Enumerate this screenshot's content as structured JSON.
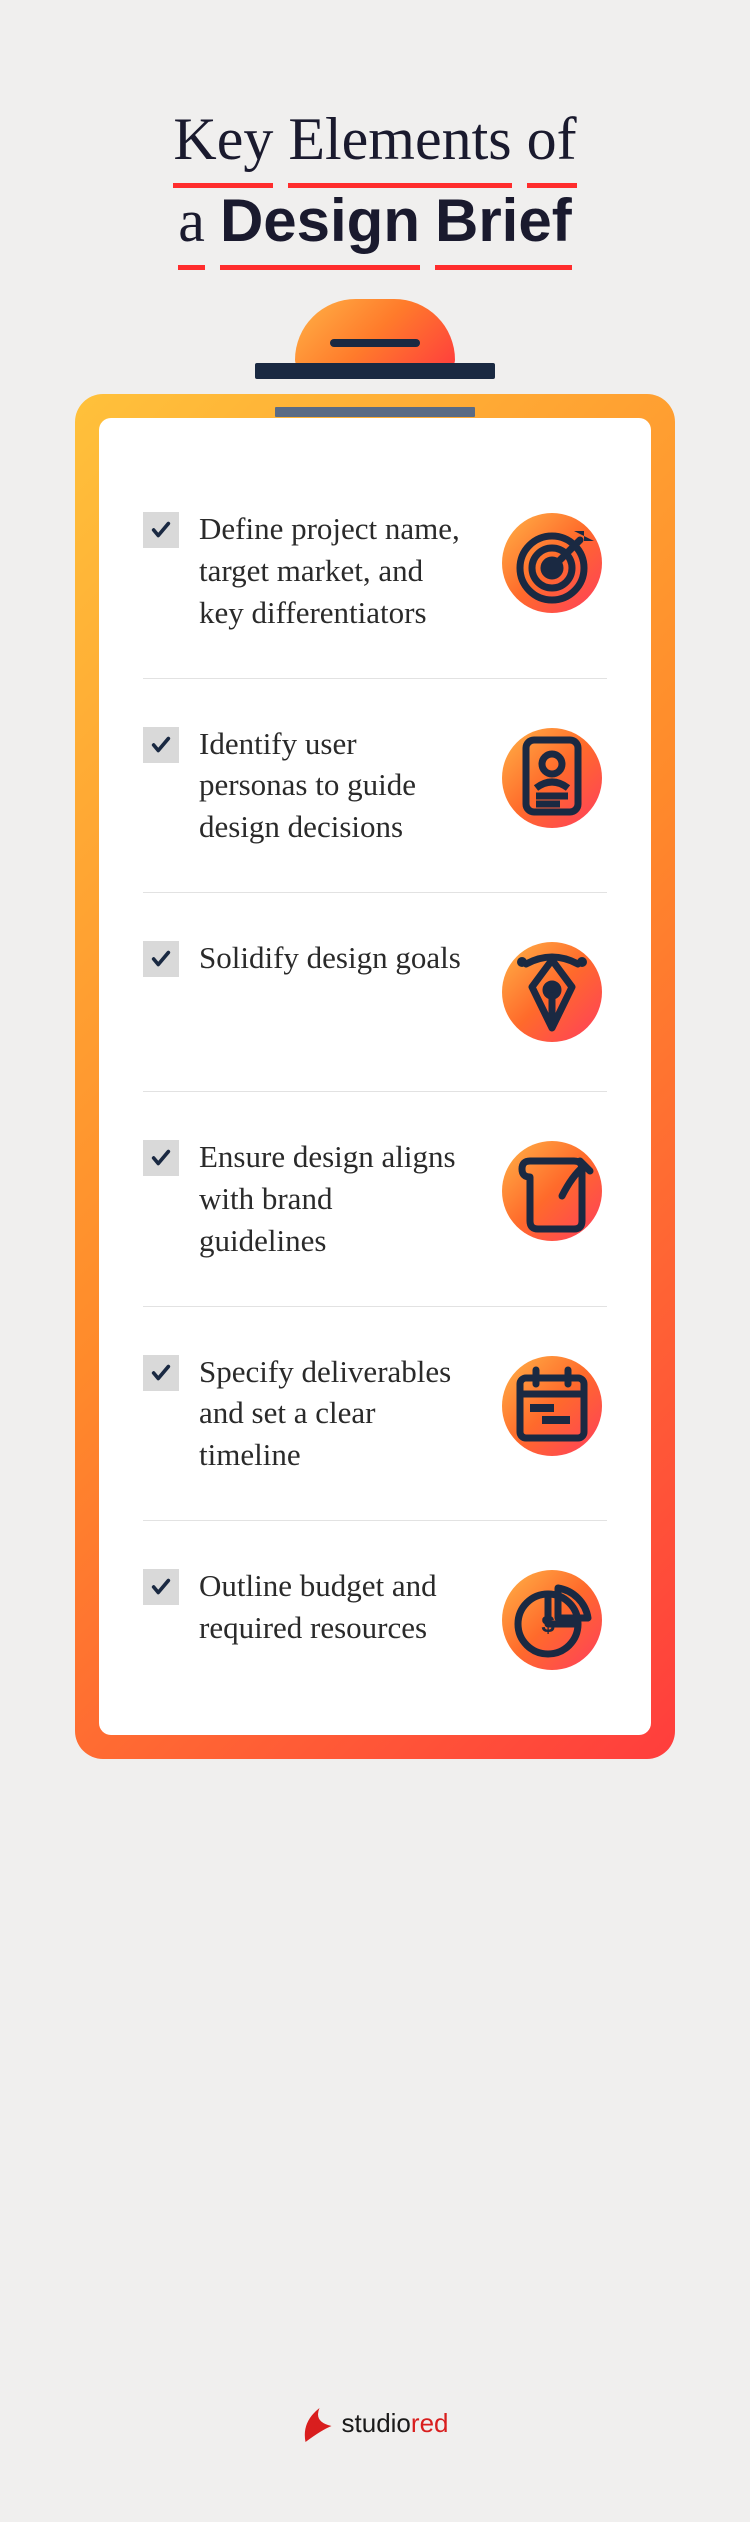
{
  "title": {
    "words": [
      "Key",
      "Elements",
      "of",
      "a",
      "Design",
      "Brief"
    ],
    "bold_words": [
      "Design",
      "Brief"
    ]
  },
  "items": [
    {
      "text": "Define project name, target market, and key differentiators",
      "icon": "target"
    },
    {
      "text": "Identify user personas to guide design decisions",
      "icon": "persona"
    },
    {
      "text": "Solidify design goals",
      "icon": "pen-nib"
    },
    {
      "text": "Ensure design aligns with brand guidelines",
      "icon": "scroll"
    },
    {
      "text": "Specify deliverables and set a clear timeline",
      "icon": "calendar"
    },
    {
      "text": "Outline budget and required resources",
      "icon": "pie-dollar"
    }
  ],
  "footer": {
    "brand_prefix": "studio",
    "brand_suffix": "red"
  },
  "colors": {
    "accent": "#ff2d2d",
    "navy": "#1a2942",
    "gradient_start": "#ffc13b",
    "gradient_end": "#ff3d3d"
  }
}
